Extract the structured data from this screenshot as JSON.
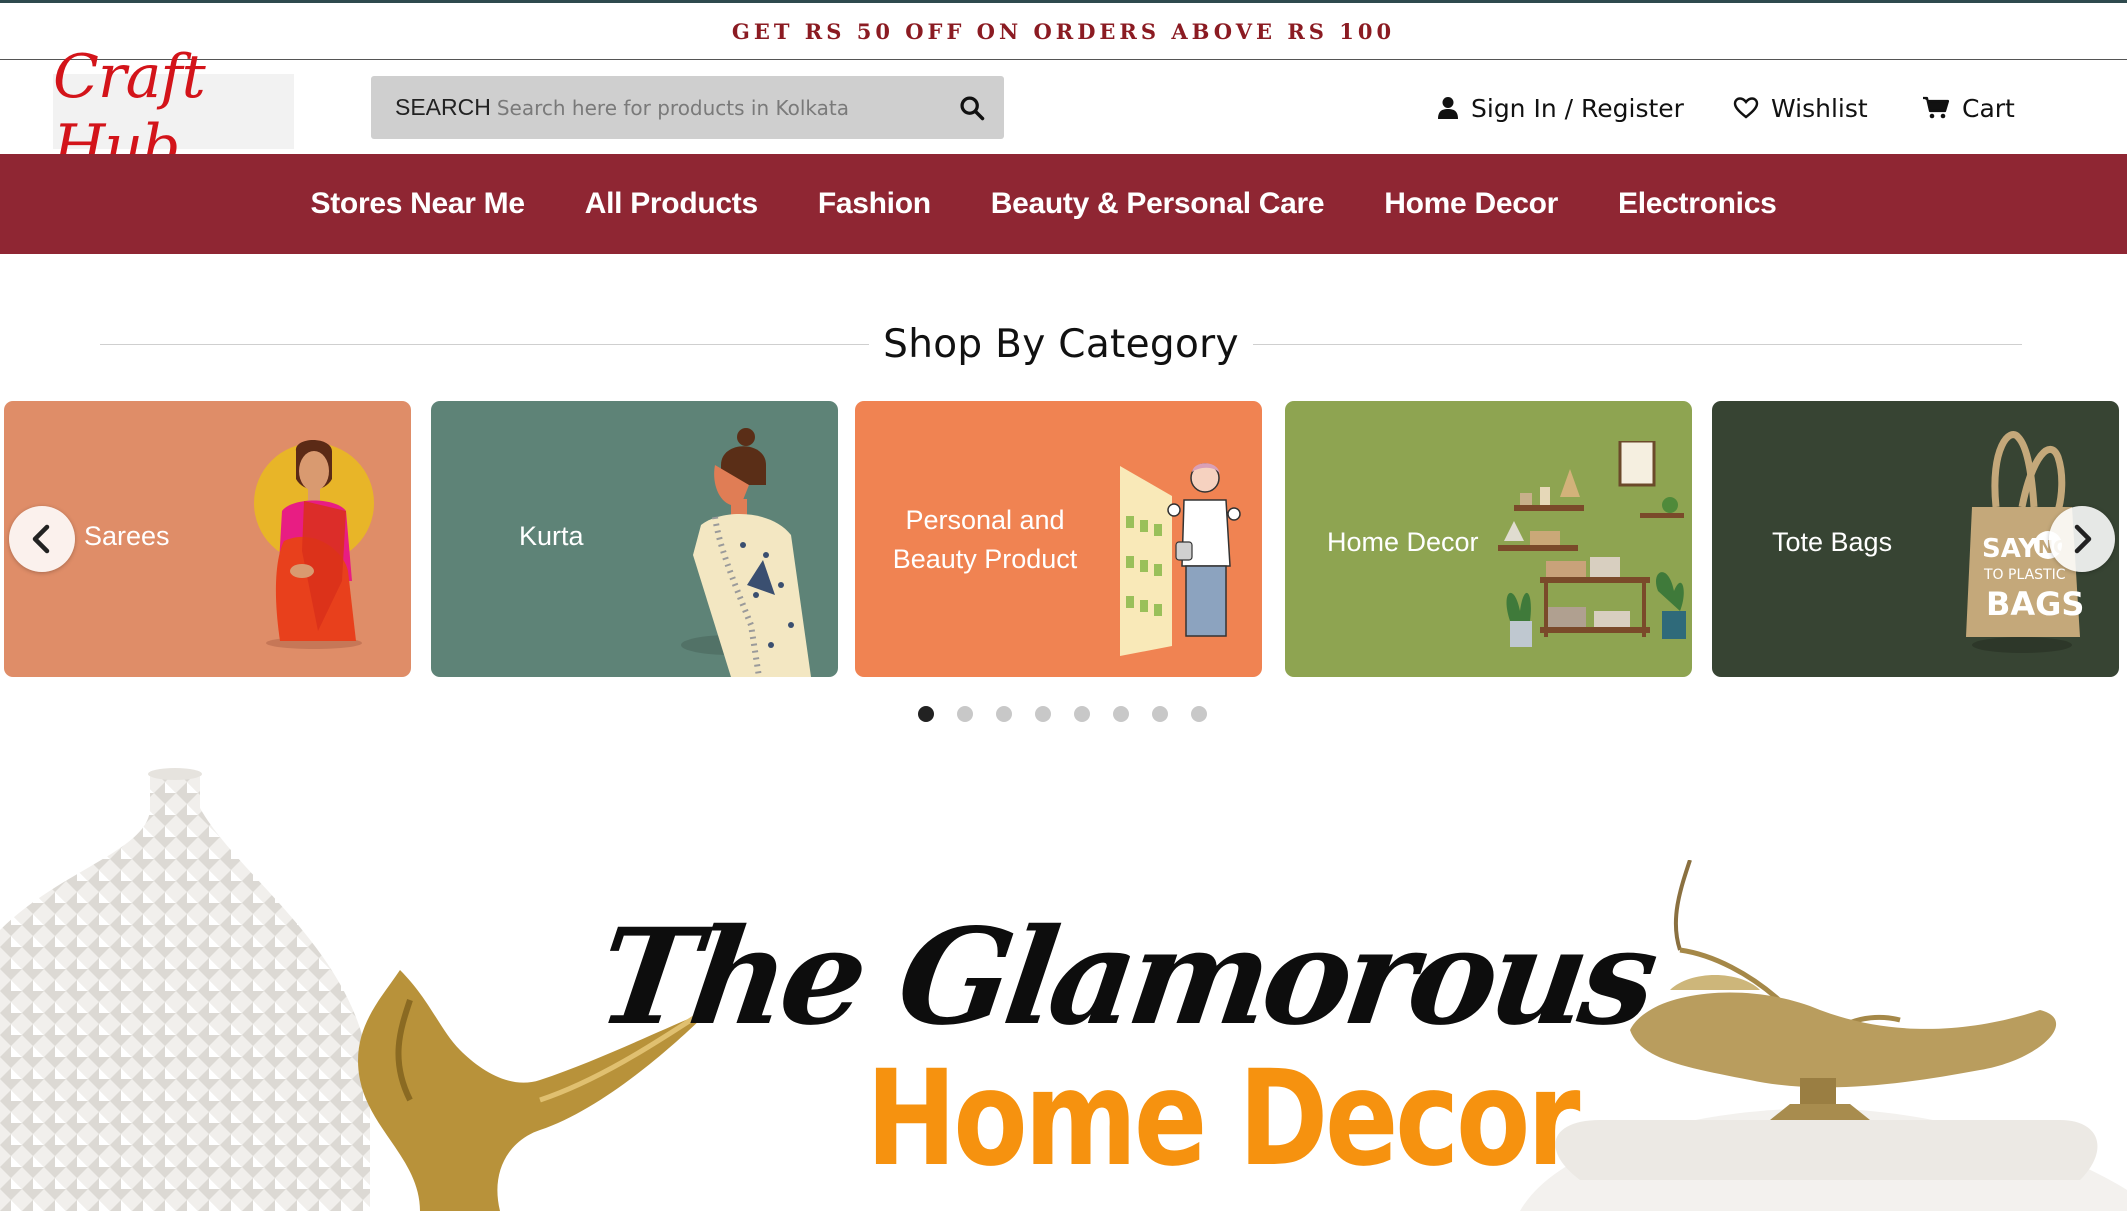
{
  "promo": {
    "text": "GET RS 50 OFF ON ORDERS ABOVE RS 100"
  },
  "header": {
    "logo_text": "Craft Hub",
    "search": {
      "label": "SEARCH",
      "placeholder": "Search here for products in Kolkata",
      "icon": "search-icon"
    },
    "links": [
      {
        "label": "Sign In / Register",
        "icon": "user-icon"
      },
      {
        "label": "Wishlist",
        "icon": "heart-icon"
      },
      {
        "label": "Cart",
        "icon": "cart-icon"
      }
    ]
  },
  "nav": {
    "items": [
      "Stores Near Me",
      "All Products",
      "Fashion",
      "Beauty & Personal Care",
      "Home Decor",
      "Electronics"
    ]
  },
  "categories": {
    "title": "Shop By Category",
    "cards": [
      {
        "label": "Sarees",
        "color": "#df8d68"
      },
      {
        "label": "Kurta",
        "color": "#5e8377"
      },
      {
        "label": "Personal and Beauty Product",
        "color": "#f08352"
      },
      {
        "label": "Home Decor",
        "color": "#8ea451"
      },
      {
        "label": "Tote Bags",
        "color": "#374433"
      }
    ],
    "prev_icon": "chevron-left-icon",
    "next_icon": "chevron-right-icon",
    "pages": 8,
    "active_page": 1
  },
  "banner": {
    "line1": "The Glamorous",
    "line2": "Home Decor"
  },
  "colors": {
    "promo_text": "#8b1b22",
    "logo": "#d3141a",
    "nav_bg": "#8f2633",
    "banner_accent": "#f6920f"
  }
}
